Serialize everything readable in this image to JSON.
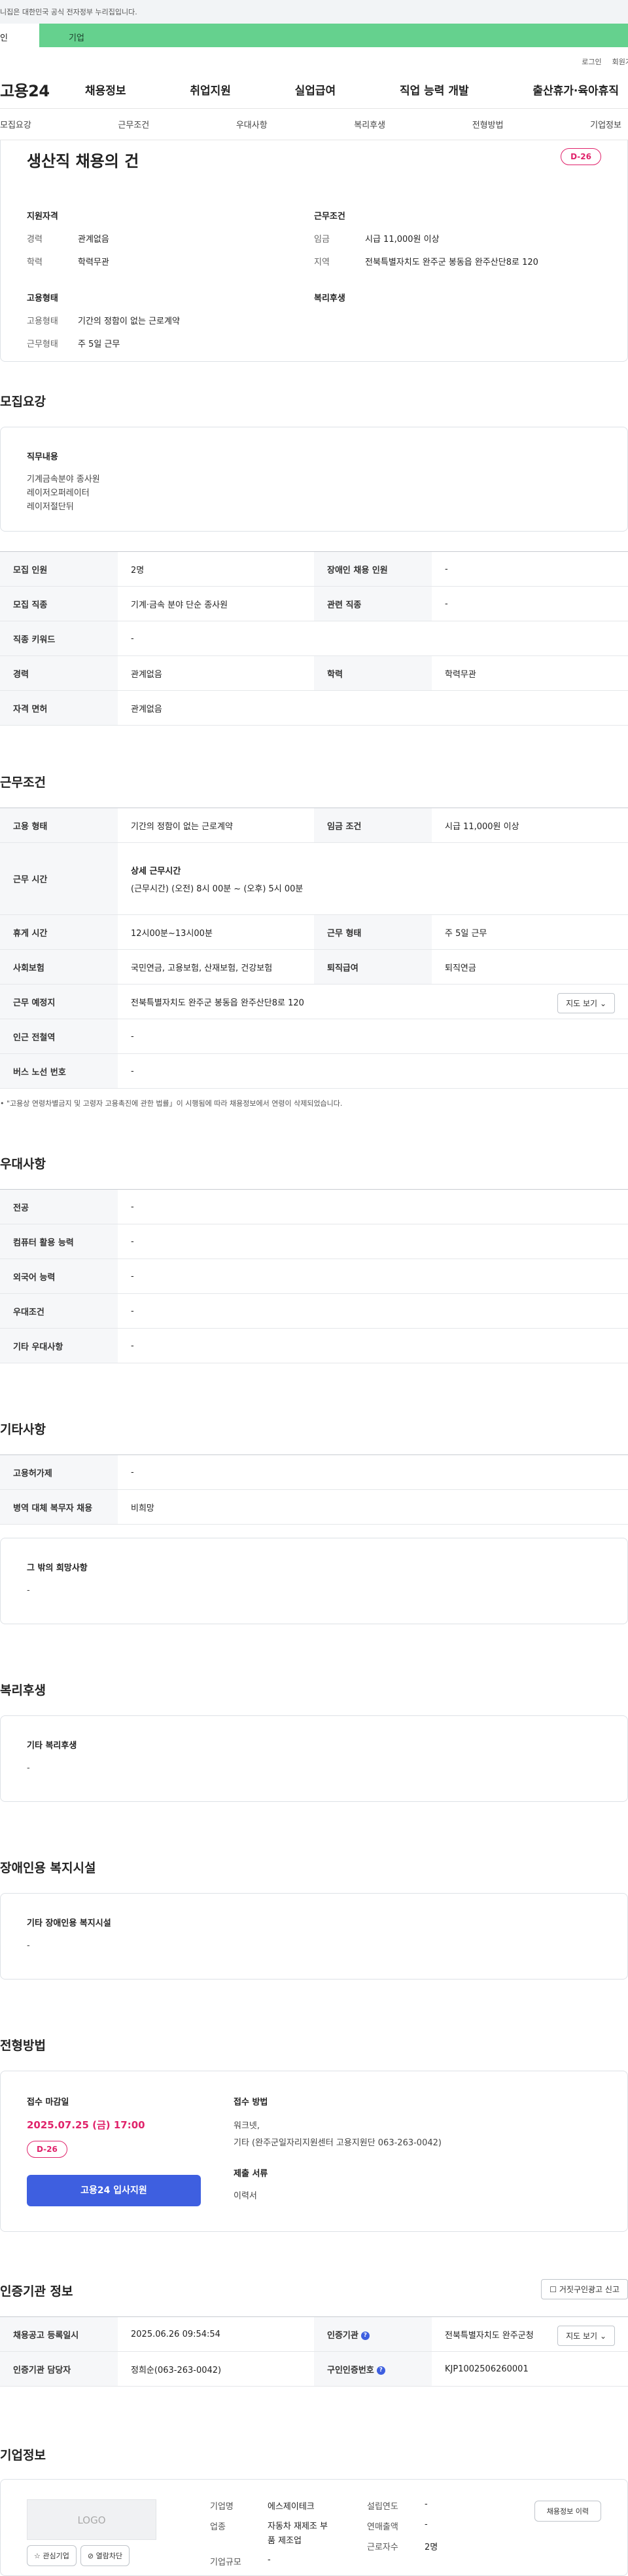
{
  "banner": {
    "text": "니집은 대한민국 공식 전자정부 누리집입니다."
  },
  "user_tabs": {
    "personal": "인",
    "corporate": "기업"
  },
  "top_links": {
    "login": "로그인",
    "join": "회원가"
  },
  "gnb": {
    "logo": "고용24",
    "menu": [
      "채용정보",
      "취업지원",
      "실업급여",
      "직업 능력 개발",
      "출산휴가·육아휴직"
    ]
  },
  "subnav": [
    "모집요강",
    "근무조건",
    "우대사항",
    "복리후생",
    "전형방법",
    "기업정보"
  ],
  "summary": {
    "title": "생산직 채용의 건",
    "dday": "D-26",
    "qualification": {
      "heading": "지원자격",
      "rows": [
        {
          "k": "경력",
          "v": "관계없음"
        },
        {
          "k": "학력",
          "v": "학력무관"
        }
      ]
    },
    "employment": {
      "heading": "고용형태",
      "rows": [
        {
          "k": "고용형태",
          "v": "기간의 정함이 없는 근로계약"
        },
        {
          "k": "근무형태",
          "v": "주 5일 근무"
        }
      ]
    },
    "conditions": {
      "heading": "근무조건",
      "rows": [
        {
          "k": "임금",
          "v": "시급 11,000원 이상"
        },
        {
          "k": "지역",
          "v": "전북특별자치도 완주군 봉동읍 완주산단8로 120"
        }
      ]
    },
    "welfare": {
      "heading": "복리후생"
    }
  },
  "recruit": {
    "title": "모집요강",
    "duty_heading": "직무내용",
    "duty_lines": [
      "기계금속분야 종사원",
      "레이저오퍼레이터",
      "레이저절단뒤"
    ],
    "rows": [
      [
        {
          "k": "모집 인원",
          "v": "2명"
        },
        {
          "k": "장애인 채용 인원",
          "v": "-"
        }
      ],
      [
        {
          "k": "모집 직종",
          "v": "기계·금속 분야 단순 종사원"
        },
        {
          "k": "관련 직종",
          "v": "-"
        }
      ],
      [
        {
          "k": "직종 키워드",
          "v": "-"
        }
      ],
      [
        {
          "k": "경력",
          "v": "관계없음"
        },
        {
          "k": "학력",
          "v": "학력무관"
        }
      ],
      [
        {
          "k": "자격 면허",
          "v": "관계없음"
        }
      ]
    ]
  },
  "work": {
    "title": "근무조건",
    "emp_type_k": "고용 형태",
    "emp_type_v": "기간의 정함이 없는 근로계약",
    "wage_k": "임금 조건",
    "wage_v": "시급 11,000원 이상",
    "hours_k": "근무 시간",
    "hours_detail_h": "상세 근무시간",
    "hours_detail_v": "(근무시간) (오전) 8시 00분 ~ (오후) 5시 00분",
    "break_k": "휴게 시간",
    "break_v": "12시00분~13시00분",
    "form_k": "근무 형태",
    "form_v": "주 5일 근무",
    "insurance_k": "사회보험",
    "insurance_v": "국민연금, 고용보험, 산재보험, 건강보험",
    "retire_k": "퇴직급여",
    "retire_v": "퇴직연금",
    "place_k": "근무 예정지",
    "place_v": "전북특별자치도 완주군 봉동읍 완주산단8로 120",
    "map_btn": "지도 보기",
    "station_k": "인근 전철역",
    "station_v": "-",
    "bus_k": "버스 노선 번호",
    "bus_v": "-",
    "note": "\"고용상 연령차별금지 및 고령자 고용촉진에 관한 법률」이 시행됨에 따라 채용정보에서 연령이 삭제되었습니다."
  },
  "prefer": {
    "title": "우대사항",
    "rows": [
      {
        "k": "전공",
        "v": "-"
      },
      {
        "k": "컴퓨터 활용 능력",
        "v": "-"
      },
      {
        "k": "외국어 능력",
        "v": "-"
      },
      {
        "k": "우대조건",
        "v": "-"
      },
      {
        "k": "기타 우대사항",
        "v": "-"
      }
    ]
  },
  "etc": {
    "title": "기타사항",
    "rows": [
      {
        "k": "고용허가제",
        "v": "-"
      },
      {
        "k": "병역 대체 복무자 채용",
        "v": "비희망"
      }
    ],
    "wish_h": "그 밖의 희망사항",
    "wish_v": "-"
  },
  "welfare": {
    "title": "복리후생",
    "h": "기타 복리후생",
    "v": "-"
  },
  "disabled": {
    "title": "장애인용 복지시설",
    "h": "기타 장애인용 복지시설",
    "v": "-"
  },
  "selection": {
    "title": "전형방법",
    "deadline_h": "접수 마감일",
    "deadline_v": "2025.07.25 (금) 17:00",
    "dday": "D-26",
    "apply_btn": "고용24 입사지원",
    "method_h": "접수 방법",
    "method_line1": "워크넷,",
    "method_line2": "기타 (완주군일자리지원센터 고용지원단 063-263-0042)",
    "docs_h": "제출 서류",
    "docs_v": "이력서"
  },
  "agency": {
    "title": "인증기관 정보",
    "report_btn": "거짓구인광고 신고",
    "reg_k": "채용공고 등록일시",
    "reg_v": "2025.06.26 09:54:54",
    "org_k": "인증기관",
    "org_v": "전북특별자치도 완주군청",
    "map_btn": "지도 보기",
    "staff_k": "인증기관 담당자",
    "staff_v": "정희순(063-263-0042)",
    "no_k": "구인인증번호",
    "no_v": "KJP1002506260001"
  },
  "company": {
    "title": "기업정보",
    "logo_text": "LOGO",
    "interest_btn": "관심기업",
    "block_btn": "열람차단",
    "name_k": "기업명",
    "name_v": "에스제이테크",
    "industry_k": "업종",
    "industry_v1": "자동차 재제조 부",
    "industry_v2": "품 제조업",
    "scale_k": "기업규모",
    "scale_v": "-",
    "found_k": "설립연도",
    "found_v": "-",
    "sales_k": "연매출액",
    "sales_v": "-",
    "workers_k": "근로자수",
    "workers_v": "2명",
    "history_btn": "채용정보 이력"
  }
}
